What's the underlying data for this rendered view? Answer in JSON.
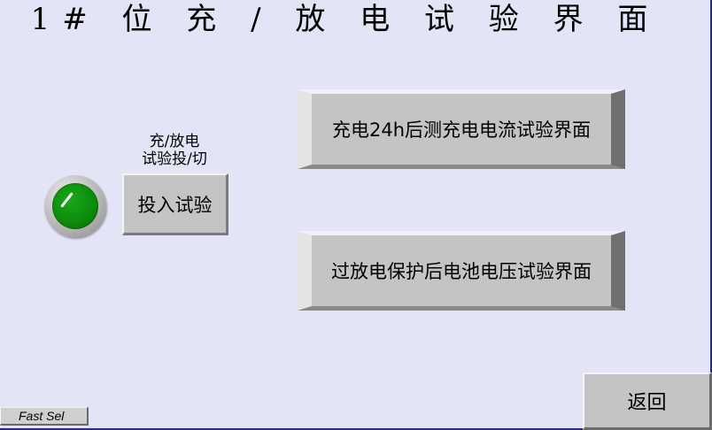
{
  "title": "1# 位 充 / 放 电 试 验 界 面",
  "indicator": {
    "icon": "status-lamp-icon",
    "color": "#0b8a0b",
    "state": "on"
  },
  "caption": {
    "line1": "充/放电",
    "line2": "试验投/切"
  },
  "buttons": {
    "toggle_test": "投入试验",
    "charge_test": "充电24h后测充电电流试验界面",
    "discharge_test": "过放电保护后电池电压试验界面",
    "back": "返回",
    "fast_sel": "Fast Sel"
  }
}
